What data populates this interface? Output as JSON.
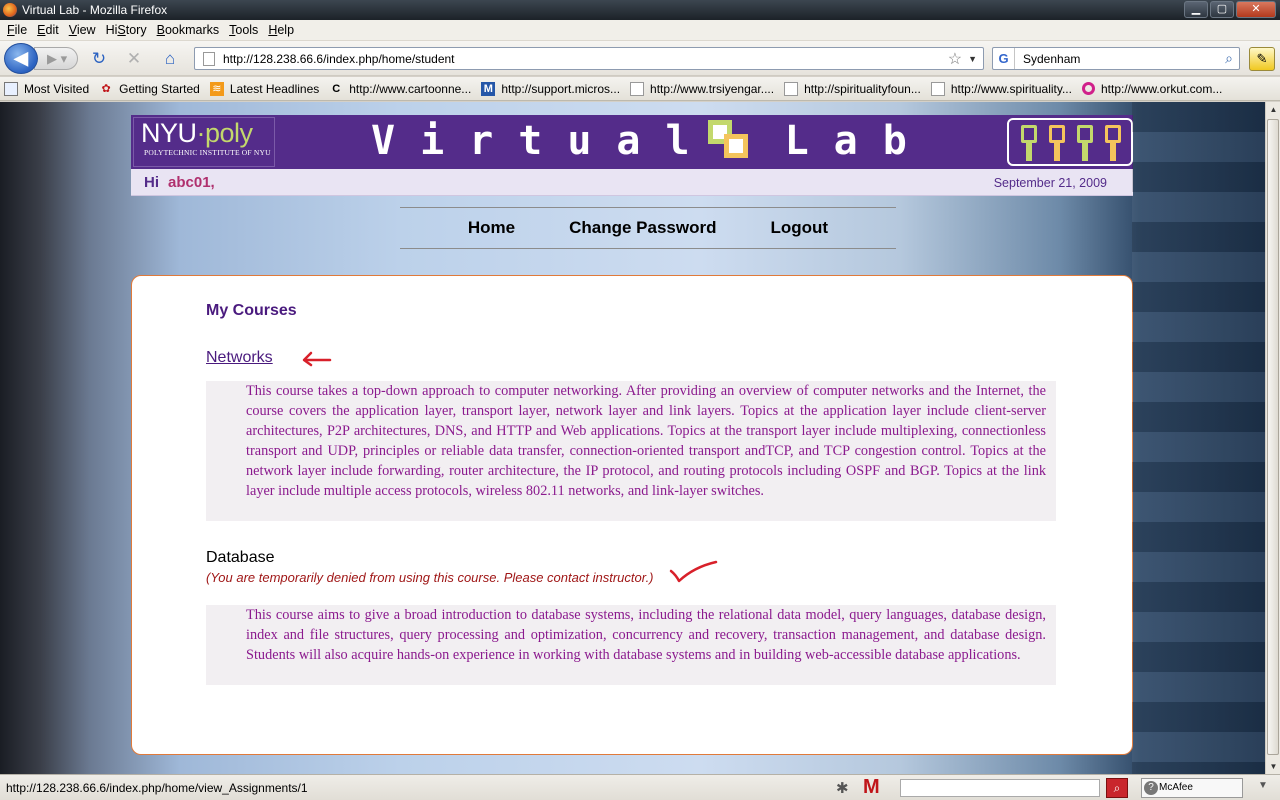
{
  "window": {
    "title": "Virtual Lab - Mozilla Firefox",
    "buttons": {
      "minimize": "▁",
      "maximize": "▢",
      "close": "✕"
    }
  },
  "menu": [
    {
      "key": "F",
      "rest": "ile"
    },
    {
      "key": "E",
      "rest": "dit"
    },
    {
      "key": "V",
      "rest": "iew"
    },
    {
      "key": "S",
      "pre": "Hi",
      "rest": "tory"
    },
    {
      "key": "B",
      "rest": "ookmarks"
    },
    {
      "key": "T",
      "rest": "ools"
    },
    {
      "key": "H",
      "rest": "elp"
    }
  ],
  "toolbar": {
    "url": "http://128.238.66.6/index.php/home/student",
    "search_value": "Sydenham",
    "search_engine": "G"
  },
  "bookmarks": [
    {
      "label": "Most Visited",
      "icon": "page-icon"
    },
    {
      "label": "Getting Started",
      "icon": "firefox-icon"
    },
    {
      "label": "Latest Headlines",
      "icon": "rss-icon"
    },
    {
      "label": "http://www.cartoonne...",
      "icon": "cn-icon"
    },
    {
      "label": "http://support.micros...",
      "icon": "msdn-icon"
    },
    {
      "label": "http://www.trsiyengar....",
      "icon": "page-icon"
    },
    {
      "label": "http://spiritualityfoun...",
      "icon": "page-icon"
    },
    {
      "label": "http://www.spirituality...",
      "icon": "page-icon"
    },
    {
      "label": "http://www.orkut.com...",
      "icon": "orkut-icon"
    }
  ],
  "site": {
    "logo_main_a": "NYU",
    "logo_main_dot": "·",
    "logo_main_b": "poly",
    "logo_sub": "POLYTECHNIC INSTITUTE OF NYU",
    "title_left": "Virtual",
    "title_right": "Lab",
    "greeting": "Hi",
    "username": "abc01,",
    "date": "September 21, 2009",
    "nav": [
      "Home",
      "Change Password",
      "Logout"
    ]
  },
  "courses": {
    "heading": "My Courses",
    "list": [
      {
        "title": "Networks",
        "description": "This course takes a top-down approach to computer networking. After providing an overview of computer networks and the Internet, the course covers the application layer, transport layer, network layer and link layers. Topics at the application layer include client-server architectures, P2P architectures, DNS, and HTTP and Web applications. Topics at the transport layer include multiplexing, connectionless transport and UDP, principles or reliable data transfer, connection-oriented transport andTCP, and TCP congestion control. Topics at the network layer include forwarding, router architecture, the IP protocol, and routing protocols including OSPF and BGP. Topics at the link layer include multiple access protocols, wireless 802.11 networks, and link-layer switches."
      },
      {
        "title": "Database",
        "notice": "(You are temporarily denied from using this course. Please contact instructor.)",
        "description": "This course aims to give a broad introduction to database systems, including the relational data model, query languages, database design, index and file structures, query processing and optimization, concurrency and recovery, transaction management, and database design. Students will also acquire hands-on experience in working with database systems and in building web-accessible database applications."
      }
    ]
  },
  "status": {
    "url": "http://128.238.66.6/index.php/home/view_Assignments/1",
    "mcafee": "McAfee SiteAdvisor"
  },
  "colors": {
    "banner": "#542c8a",
    "accent_green": "#c3d86c",
    "accent_orange": "#f4c45c",
    "course_text": "#8b1a8e",
    "panel_border": "#e07a3a",
    "annotation_red": "#d8202a"
  }
}
